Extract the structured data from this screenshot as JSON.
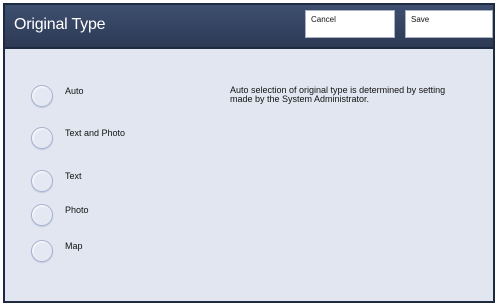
{
  "header": {
    "title": "Original Type",
    "cancel_label": "Cancel",
    "save_label": "Save"
  },
  "options": [
    {
      "label": "Auto"
    },
    {
      "label": "Text and Photo"
    },
    {
      "label": "Text"
    },
    {
      "label": "Photo"
    },
    {
      "label": "Map"
    }
  ],
  "description": "Auto selection of original type is determined by setting made by the System Administrator."
}
